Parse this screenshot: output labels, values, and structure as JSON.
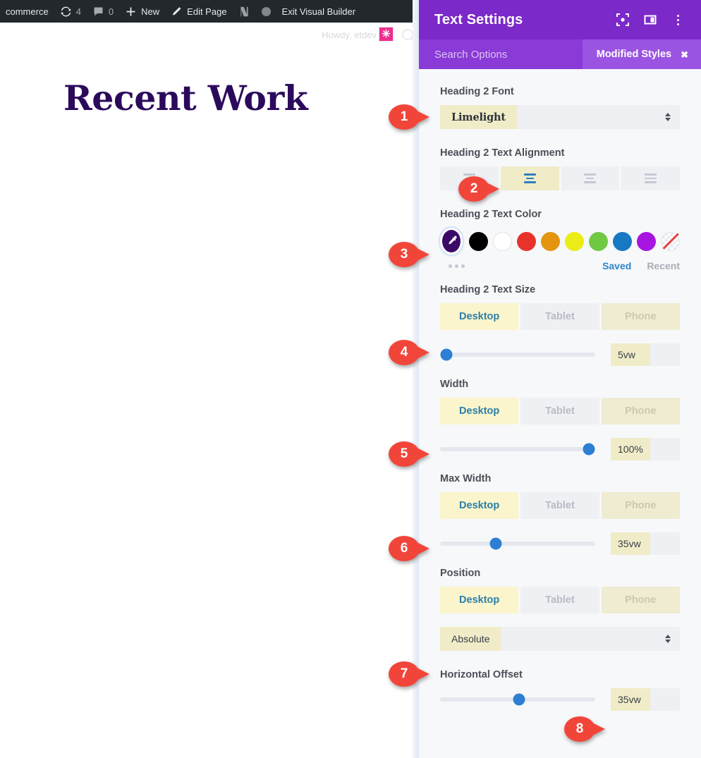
{
  "adminbar": {
    "items": [
      {
        "icon": "woocommerce-icon",
        "label": "commerce",
        "name": "adminbar-woocommerce"
      },
      {
        "icon": "updates-icon",
        "label": "4",
        "name": "adminbar-updates"
      },
      {
        "icon": "comments-icon",
        "label": "0",
        "name": "adminbar-comments"
      },
      {
        "icon": "plus-icon",
        "label": "New",
        "name": "adminbar-new"
      },
      {
        "icon": "pencil-icon",
        "label": "Edit Page",
        "name": "adminbar-edit-page"
      },
      {
        "icon": "yoast-icon",
        "label": "",
        "name": "adminbar-yoast"
      },
      {
        "icon": "circle-icon",
        "label": "",
        "name": "adminbar-status"
      },
      {
        "icon": "",
        "label": "Exit Visual Builder",
        "name": "adminbar-exit-visual-builder"
      }
    ]
  },
  "sitebar": {
    "howdy": "Howdy, etdev",
    "avatar_glyph": "✳",
    "search_icon": "search-icon"
  },
  "canvas": {
    "heading": "Recent Work",
    "heading_color": "#2b0a5c"
  },
  "panel": {
    "title": "Text Settings",
    "header_icons": [
      {
        "name": "focus-target-icon",
        "label": "focus-target-icon"
      },
      {
        "name": "split-panel-icon",
        "label": "split-panel-icon"
      },
      {
        "name": "kebab-menu-icon",
        "label": "kebab-menu-icon"
      }
    ],
    "search_placeholder": "Search Options",
    "search_value": "",
    "modified_badge": "Modified Styles",
    "modified_badge_close": "✖",
    "accent": "#7b29c9",
    "accent_light": "#8a3ad6",
    "badge_bg": "#9b54e2"
  },
  "fields": {
    "font": {
      "label": "Heading 2 Font",
      "value": "Limelight",
      "callout": "1"
    },
    "alignment": {
      "label": "Heading 2 Text Alignment",
      "options": [
        "align-left",
        "align-center",
        "align-right",
        "align-justify"
      ],
      "selected_index": 1,
      "callout": "2"
    },
    "color": {
      "label": "Heading 2 Text Color",
      "selected": "#3b0a68",
      "selected_icon": "eyedropper-icon",
      "swatches": [
        "#000000",
        "#ffffff",
        "#e8332d",
        "#e4940e",
        "#ecec18",
        "#6fc942",
        "#1778c4",
        "#a814e0",
        "none"
      ],
      "saved_label": "Saved",
      "recent_label": "Recent",
      "more_icon": "ellipsis-icon",
      "callout": "3"
    },
    "text_size": {
      "label": "Heading 2 Text Size",
      "tabs": [
        "Desktop",
        "Tablet",
        "Phone"
      ],
      "active_tab": "Desktop",
      "slider_percent": 4,
      "value": "5vw",
      "callout": "4"
    },
    "width": {
      "label": "Width",
      "tabs": [
        "Desktop",
        "Tablet",
        "Phone"
      ],
      "active_tab": "Desktop",
      "slider_percent": 96,
      "value": "100%",
      "callout": "5"
    },
    "max_width": {
      "label": "Max Width",
      "tabs": [
        "Desktop",
        "Tablet",
        "Phone"
      ],
      "active_tab": "Desktop",
      "slider_percent": 36,
      "value": "35vw",
      "callout": "6"
    },
    "position": {
      "label": "Position",
      "tabs": [
        "Desktop",
        "Tablet",
        "Phone"
      ],
      "active_tab": "Desktop",
      "value": "Absolute",
      "callout": "7"
    },
    "horizontal_offset": {
      "label": "Horizontal Offset",
      "slider_percent": 51,
      "value": "35vw",
      "callout": "8"
    }
  }
}
